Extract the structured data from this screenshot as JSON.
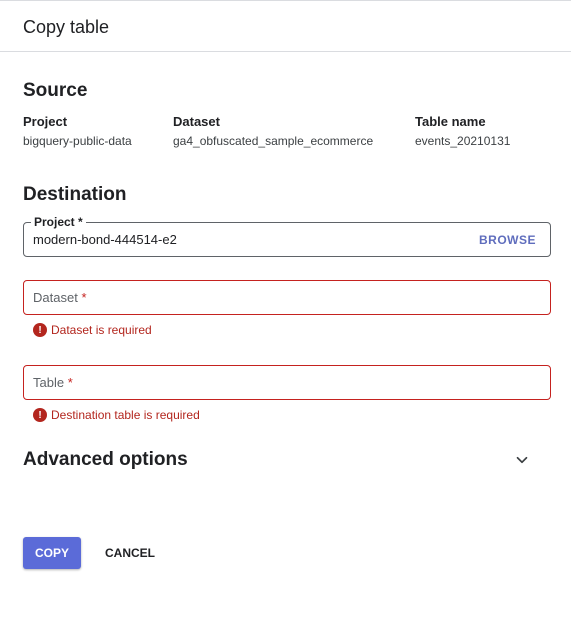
{
  "header": {
    "title": "Copy table"
  },
  "source": {
    "title": "Source",
    "columns": [
      {
        "label": "Project",
        "value": "bigquery-public-data"
      },
      {
        "label": "Dataset",
        "value": "ga4_obfuscated_sample_ecommerce"
      },
      {
        "label": "Table name",
        "value": "events_20210131"
      }
    ]
  },
  "destination": {
    "title": "Destination",
    "project": {
      "label": "Project *",
      "value": "modern-bond-444514-e2",
      "browse_label": "BROWSE"
    },
    "dataset": {
      "placeholder": "Dataset",
      "required_mark": "*",
      "error": "Dataset is required"
    },
    "table": {
      "placeholder": "Table",
      "required_mark": "*",
      "error": "Destination table is required"
    }
  },
  "advanced": {
    "title": "Advanced options"
  },
  "actions": {
    "copy_label": "COPY",
    "cancel_label": "CANCEL"
  },
  "colors": {
    "primary": "#5b6bd8",
    "error": "#b3261e",
    "border": "#dadce0"
  },
  "icons": {
    "error": "error-circle-icon",
    "expand": "chevron-down-icon"
  }
}
